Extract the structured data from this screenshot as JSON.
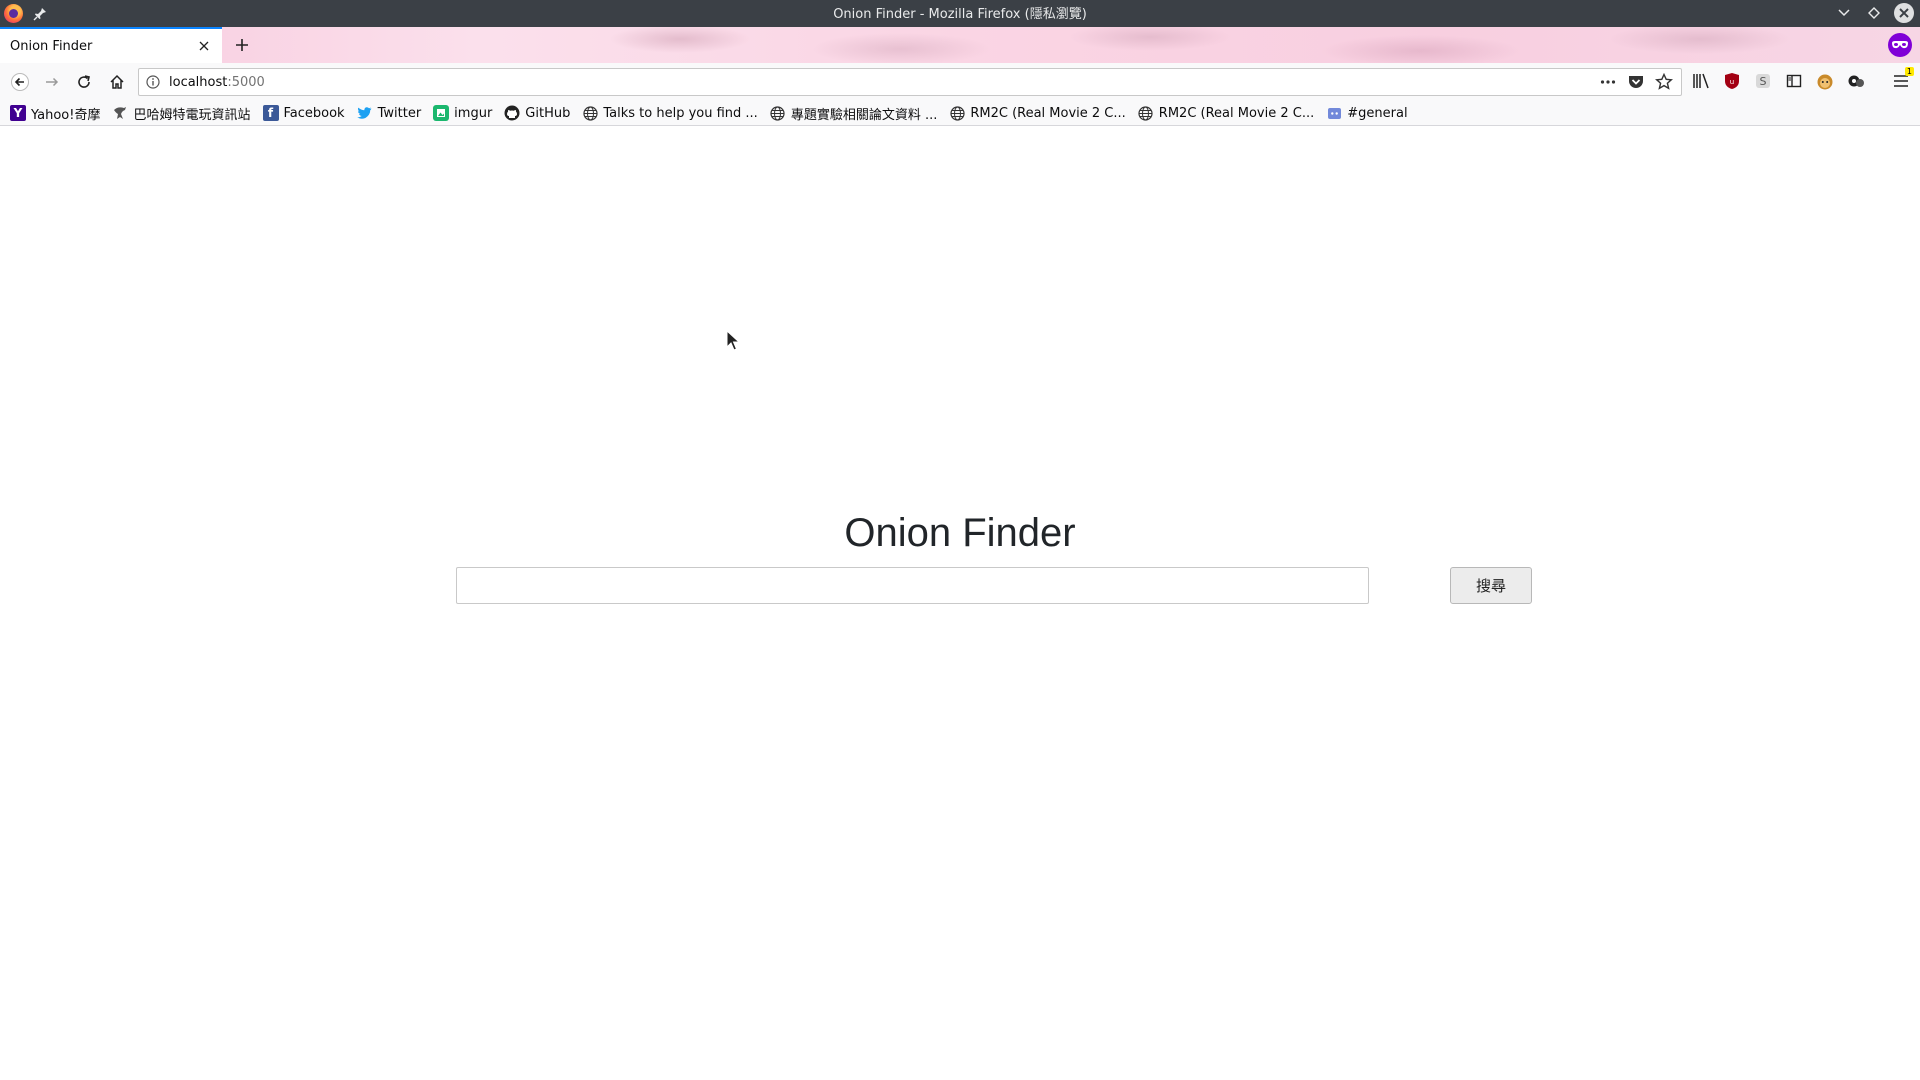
{
  "window": {
    "title": "Onion Finder - Mozilla Firefox (隱私瀏覽)"
  },
  "tabs": [
    {
      "label": "Onion Finder",
      "active": true
    }
  ],
  "urlbar": {
    "host": "localhost",
    "port": ":5000"
  },
  "bookmarks": [
    {
      "label": "Yahoo!奇摩",
      "icon": "yahoo-icon"
    },
    {
      "label": "巴哈姆特電玩資訊站",
      "icon": "bahamut-icon"
    },
    {
      "label": "Facebook",
      "icon": "facebook-icon"
    },
    {
      "label": "Twitter",
      "icon": "twitter-icon"
    },
    {
      "label": "imgur",
      "icon": "imgur-icon"
    },
    {
      "label": "GitHub",
      "icon": "github-icon"
    },
    {
      "label": "Talks to help you find ...",
      "icon": "globe-icon"
    },
    {
      "label": "專題實驗相關論文資料 ...",
      "icon": "globe-icon"
    },
    {
      "label": "RM2C (Real Movie 2 C...",
      "icon": "globe-icon"
    },
    {
      "label": "RM2C (Real Movie 2 C...",
      "icon": "globe-icon"
    },
    {
      "label": "#general",
      "icon": "discord-icon"
    }
  ],
  "toolbar": {
    "notification_badge": "1"
  },
  "page": {
    "title": "Onion Finder",
    "search_value": "",
    "search_button_label": "搜尋"
  },
  "colors": {
    "accent": "#0a84ff",
    "private_browsing": "#8000d7",
    "titlebar": "#3b4046"
  }
}
